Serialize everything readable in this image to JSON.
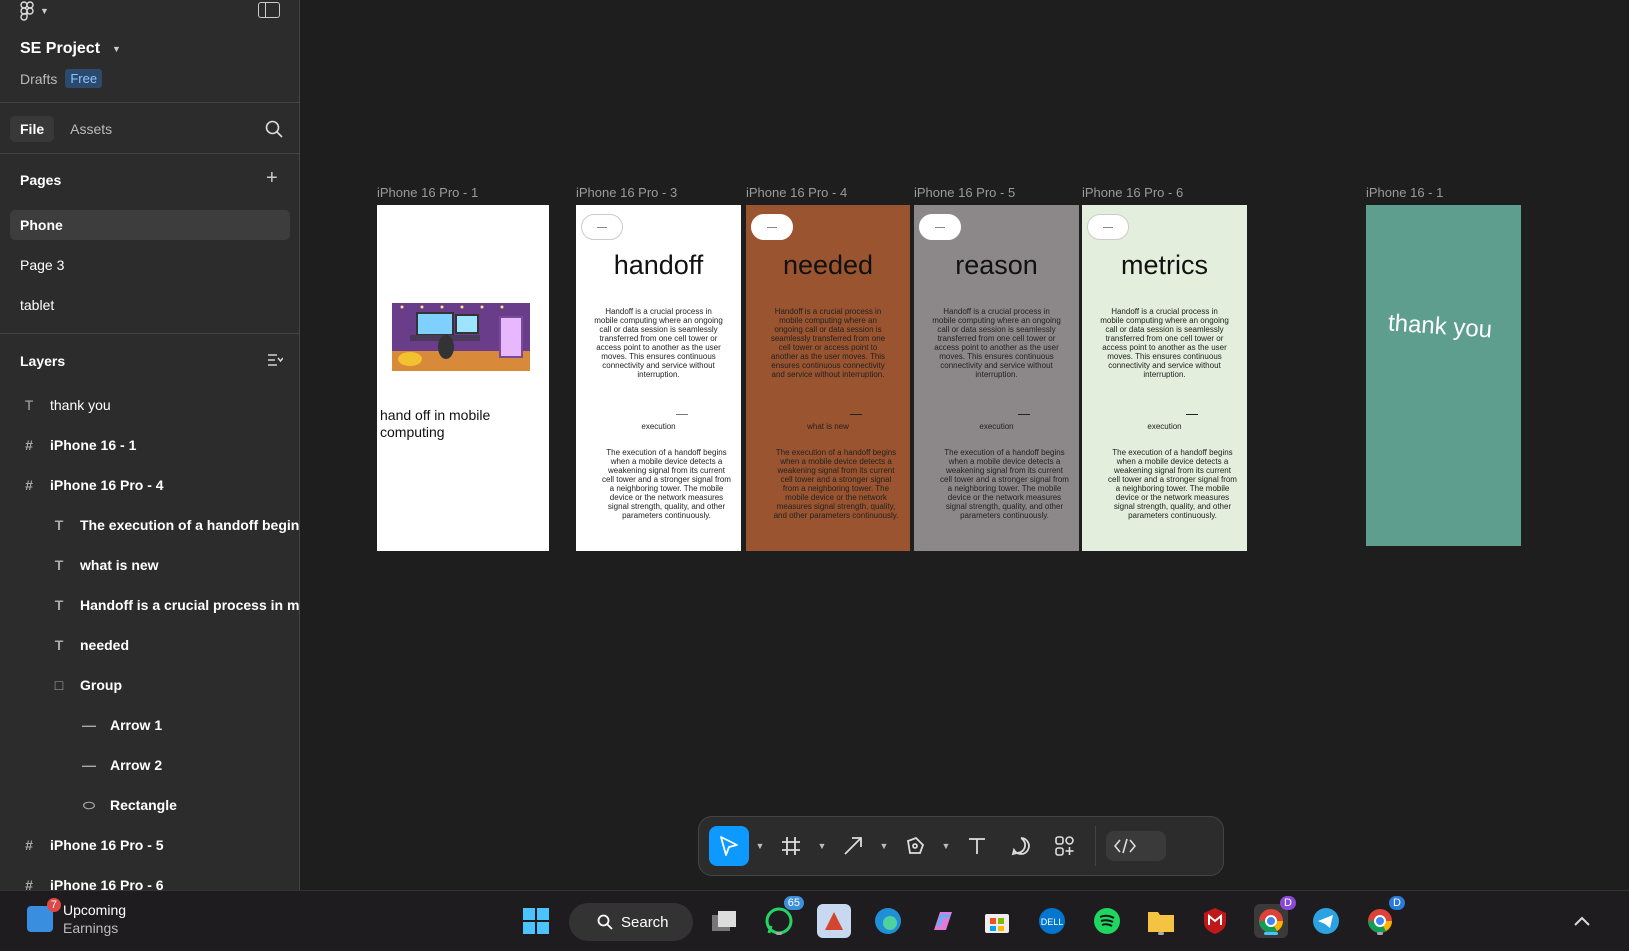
{
  "sidebar": {
    "project_name": "SE Project",
    "drafts_label": "Drafts",
    "plan_badge": "Free",
    "tabs": {
      "file": "File",
      "assets": "Assets"
    },
    "pages_title": "Pages",
    "pages": [
      "Phone",
      "Page 3",
      "tablet"
    ],
    "layers_title": "Layers",
    "layers": [
      {
        "label": "thank you",
        "icon": "text-icon"
      },
      {
        "label": "iPhone 16 - 1",
        "icon": "frame-icon"
      },
      {
        "label": "iPhone 16 Pro - 4",
        "icon": "frame-icon"
      },
      {
        "label": "The execution of a handoff begins",
        "icon": "text-icon"
      },
      {
        "label": "what is new",
        "icon": "text-icon"
      },
      {
        "label": "Handoff is a crucial process in mo",
        "icon": "text-icon"
      },
      {
        "label": "needed",
        "icon": "text-icon"
      },
      {
        "label": "Group",
        "icon": "group-icon"
      },
      {
        "label": "Arrow 1",
        "icon": "line-icon"
      },
      {
        "label": "Arrow 2",
        "icon": "line-icon"
      },
      {
        "label": "Rectangle",
        "icon": "ellipse-icon"
      },
      {
        "label": "iPhone 16 Pro - 5",
        "icon": "frame-icon"
      },
      {
        "label": "iPhone 16 Pro - 6",
        "icon": "frame-icon"
      }
    ]
  },
  "canvas": {
    "frames": {
      "f1": {
        "label": "iPhone 16 Pro - 1",
        "text": "hand off in mobile computing",
        "bg": "#ffffff"
      },
      "f3": {
        "label": "iPhone 16 Pro - 3",
        "heading": "handoff",
        "mid": "execution",
        "bg": "#ffffff"
      },
      "f4": {
        "label": "iPhone 16 Pro - 4",
        "heading": "needed",
        "mid": "what is new",
        "bg": "#9b5430"
      },
      "f5": {
        "label": "iPhone 16 Pro - 5",
        "heading": "reason",
        "mid": "execution",
        "bg": "#8c8789"
      },
      "f6": {
        "label": "iPhone 16 Pro - 6",
        "heading": "metrics",
        "mid": "execution",
        "bg": "#e3eedc"
      },
      "f7": {
        "label": "iPhone 16 - 1",
        "text": "thank you",
        "bg": "#5e9e8e"
      }
    },
    "para1": "Handoff is a crucial process in mobile computing where an ongoing call or data session is seamlessly transferred from one cell tower or access point to another as the user moves. This ensures continuous connectivity and service without interruption.",
    "para2": "The execution of a handoff begins when a mobile device detects a weakening signal from its current cell tower and a stronger signal from a neighboring tower. The mobile device or the network measures signal strength, quality, and other parameters continuously."
  },
  "toolbar": {
    "tools": [
      "move-tool",
      "frame-tool",
      "shape-tool",
      "pen-tool",
      "text-tool",
      "comment-tool",
      "actions-tool",
      "dev-mode-toggle"
    ],
    "accent": "#0d99ff"
  },
  "taskbar": {
    "widget_badge": "7",
    "widget_title": "Upcoming",
    "widget_sub": "Earnings",
    "search_label": "Search",
    "whatsapp_badge": "65",
    "chrome_profile": "D"
  }
}
